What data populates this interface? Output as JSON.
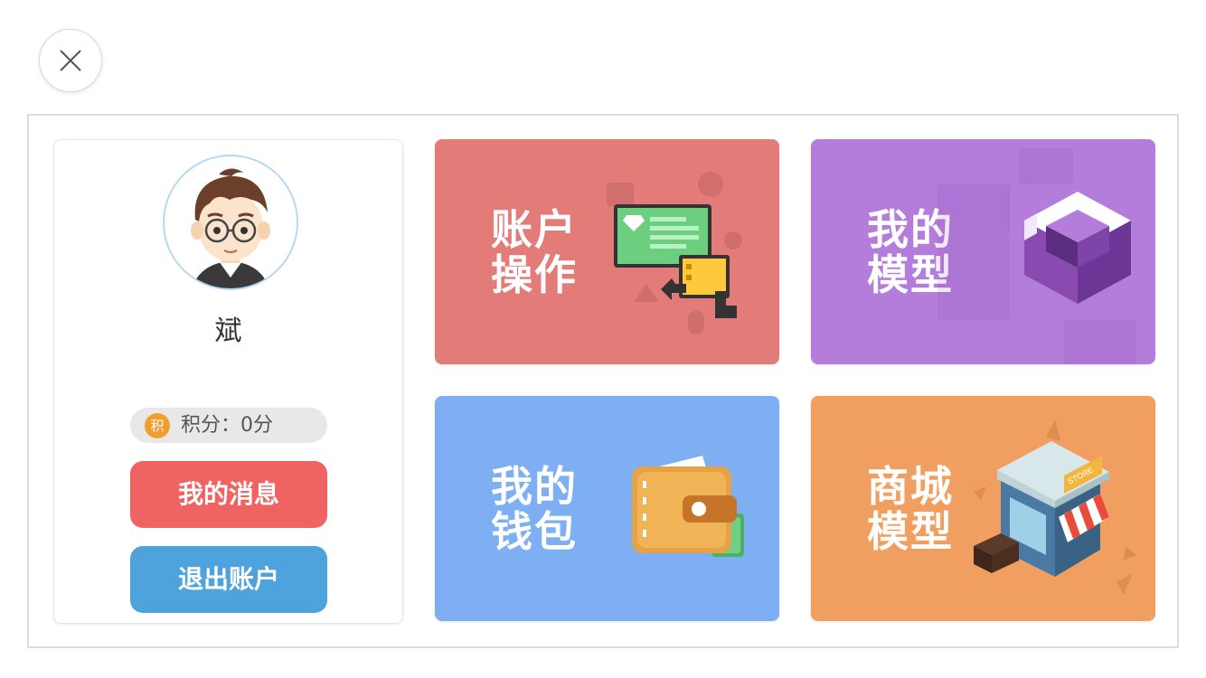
{
  "close_button": {
    "icon": "close-icon"
  },
  "profile": {
    "username": "斌",
    "points_badge": "积",
    "points_text": "积分：0分",
    "messages_label": "我的消息",
    "logout_label": "退出账户"
  },
  "tiles": {
    "account": {
      "line1": "账户",
      "line2": "操作",
      "color": "#e37c79"
    },
    "model": {
      "line1": "我的",
      "line2": "模型",
      "color": "#b57ddb"
    },
    "wallet": {
      "line1": "我的",
      "line2": "钱包",
      "color": "#7faff3"
    },
    "store": {
      "line1": "商城",
      "line2": "模型",
      "color": "#f19f61",
      "sign": "STORE"
    }
  },
  "colors": {
    "messages_button": "#ef6362",
    "logout_button": "#4fa3dd",
    "points_badge": "#f09f2e"
  }
}
